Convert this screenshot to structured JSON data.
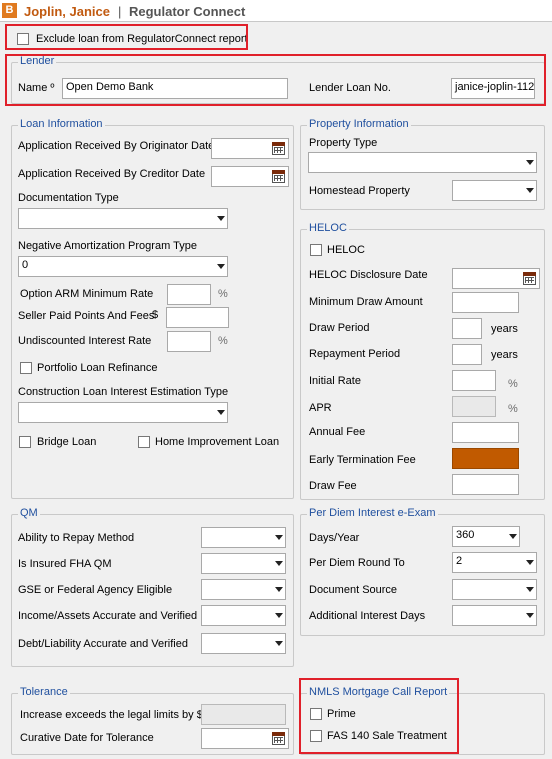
{
  "titlebar": {
    "logo": "B",
    "name": "Joplin, Janice",
    "separator": "|",
    "app": "Regulator Connect"
  },
  "exclude": {
    "label": "Exclude loan from RegulatorConnect report"
  },
  "lender": {
    "legend": "Lender",
    "name_label": "Name",
    "required_mark": "º",
    "name_value": "Open Demo Bank",
    "loan_no_label": "Lender Loan No.",
    "loan_no_value": "janice-joplin-112"
  },
  "loan_info": {
    "legend": "Loan Information",
    "app_received_originator": "Application Received By Originator Date",
    "app_received_creditor": "Application Received By Creditor Date",
    "doc_type": "Documentation Type",
    "neg_am": "Negative Amortization Program Type",
    "neg_am_value": "0",
    "option_arm": "Option ARM Minimum Rate",
    "seller_paid": "Seller Paid Points And Fees",
    "undiscounted": "Undiscounted Interest Rate",
    "portfolio": "Portfolio Loan Refinance",
    "construction": "Construction Loan Interest Estimation Type",
    "bridge": "Bridge Loan",
    "home_improvement": "Home Improvement Loan",
    "pct": "%",
    "dollar": "$"
  },
  "property": {
    "legend": "Property Information",
    "property_type": "Property Type",
    "homestead": "Homestead Property"
  },
  "heloc": {
    "legend": "HELOC",
    "heloc_cb": "HELOC",
    "disclosure_date": "HELOC Disclosure Date",
    "min_draw": "Minimum Draw Amount",
    "draw_period": "Draw Period",
    "repayment_period": "Repayment Period",
    "years": "years",
    "initial_rate": "Initial Rate",
    "apr": "APR",
    "annual_fee": "Annual Fee",
    "early_term": "Early Termination Fee",
    "draw_fee": "Draw Fee",
    "pct": "%"
  },
  "qm": {
    "legend": "QM",
    "ability": "Ability to Repay Method",
    "fha": "Is Insured FHA QM",
    "gse": "GSE or Federal Agency Eligible",
    "income": "Income/Assets Accurate and Verified",
    "debt": "Debt/Liability Accurate and Verified"
  },
  "per_diem": {
    "legend": "Per Diem Interest e-Exam",
    "days_year": "Days/Year",
    "days_year_value": "360",
    "round_to": "Per Diem Round To",
    "round_to_value": "2",
    "doc_source": "Document Source",
    "add_days": "Additional Interest Days"
  },
  "tolerance": {
    "legend": "Tolerance",
    "exceeds": "Increase exceeds the legal limits by $",
    "curative": "Curative Date for Tolerance"
  },
  "nmls": {
    "legend": "NMLS Mortgage Call Report",
    "prime": "Prime",
    "fas140": "FAS 140 Sale Treatment"
  },
  "colors": {
    "accent": "#c15a10",
    "legend_blue": "#1f4f9e",
    "highlight_red": "#e0202a",
    "early_term_fill": "#c15a00"
  }
}
